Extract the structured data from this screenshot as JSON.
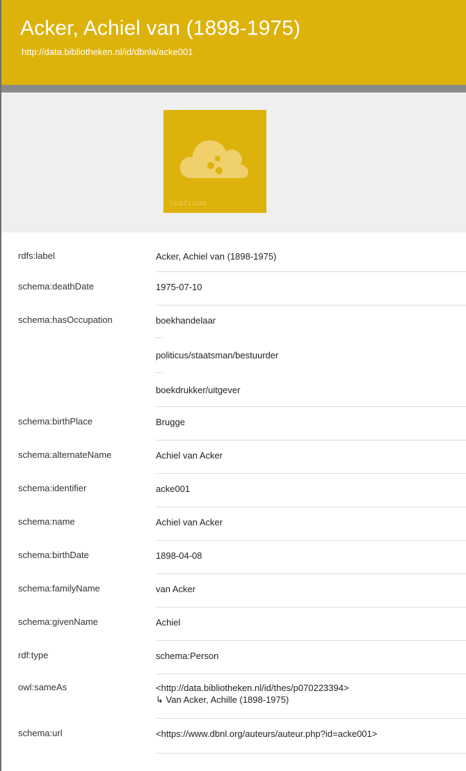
{
  "header": {
    "title": "Acker, Achiel van (1898-1975)",
    "uri": "http://data.bibliotheken.nl/id/dbnla/acke001"
  },
  "logo": {
    "text": "LODCLOUD",
    "icon": "cloud-icon",
    "color": "#ddb20b"
  },
  "properties": [
    {
      "predicate": "rdfs:label",
      "values": [
        "Acker, Achiel van (1898-1975)"
      ]
    },
    {
      "predicate": "schema:deathDate",
      "values": [
        "1975-07-10"
      ]
    },
    {
      "predicate": "schema:hasOccupation",
      "values": [
        "boekhandelaar",
        "politicus/staatsman/bestuurder",
        "boekdrukker/uitgever"
      ]
    },
    {
      "predicate": "schema:birthPlace",
      "values": [
        "Brugge"
      ]
    },
    {
      "predicate": "schema:alternateName",
      "values": [
        "Achiel van Acker"
      ]
    },
    {
      "predicate": "schema:identifier",
      "values": [
        "acke001"
      ]
    },
    {
      "predicate": "schema:name",
      "values": [
        "Achiel van Acker"
      ]
    },
    {
      "predicate": "schema:birthDate",
      "values": [
        "1898-04-08"
      ]
    },
    {
      "predicate": "schema:familyName",
      "values": [
        "van Acker"
      ]
    },
    {
      "predicate": "schema:givenName",
      "values": [
        "Achiel"
      ]
    },
    {
      "predicate": "rdf:type",
      "values": [
        "schema:Person"
      ]
    },
    {
      "predicate": "owl:sameAs",
      "values": [
        "<http://data.bibliotheken.nl/id/thes/p070223394>"
      ],
      "sublabel": "↳ Van Acker, Achille (1898-1975)"
    },
    {
      "predicate": "schema:url",
      "values": [
        "<https://www.dbnl.org/auteurs/auteur.php?id=acke001>"
      ]
    }
  ]
}
